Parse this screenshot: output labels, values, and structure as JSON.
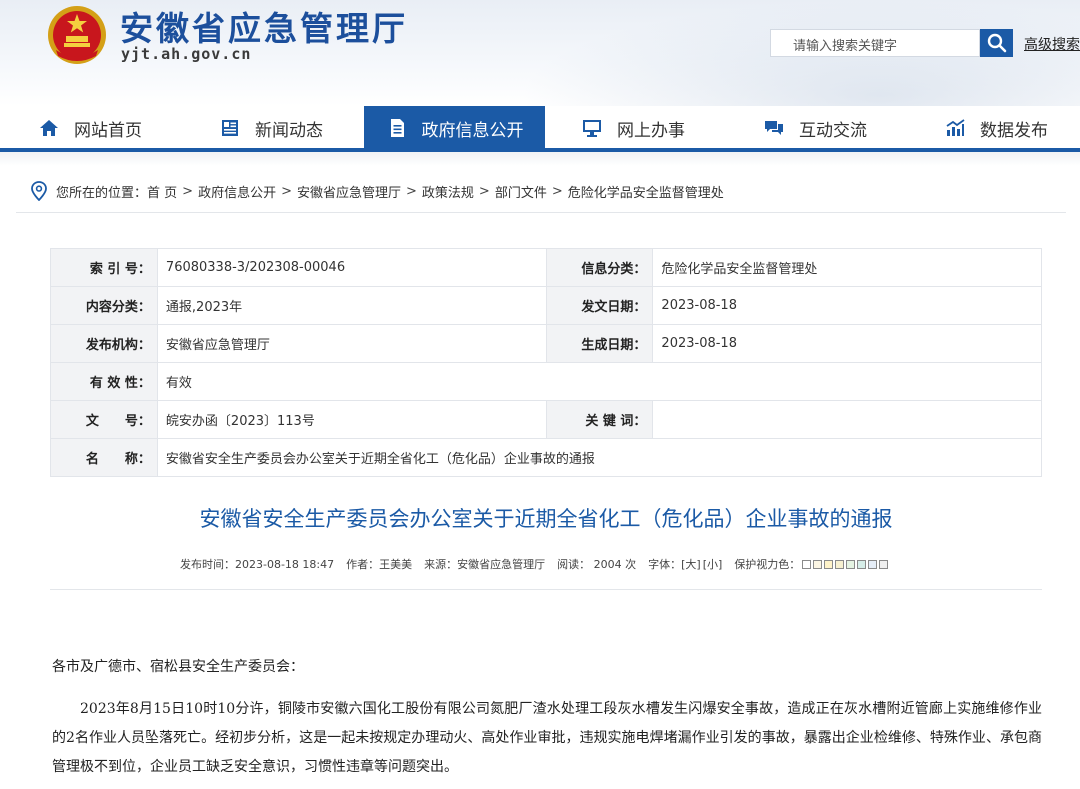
{
  "header": {
    "site_title": "安徽省应急管理厅",
    "site_domain": "yjt.ah.gov.cn",
    "search_placeholder": "请输入搜索关键字",
    "advanced_search": "高级搜索",
    "brand_color": "#1b5aa6"
  },
  "nav": {
    "items": [
      {
        "label": "网站首页",
        "icon": "home-icon"
      },
      {
        "label": "新闻动态",
        "icon": "news-icon"
      },
      {
        "label": "政府信息公开",
        "icon": "document-icon",
        "active": true
      },
      {
        "label": "网上办事",
        "icon": "monitor-icon"
      },
      {
        "label": "互动交流",
        "icon": "chat-icon"
      },
      {
        "label": "数据发布",
        "icon": "chart-icon"
      }
    ]
  },
  "breadcrumb": {
    "prefix": "您所在的位置：",
    "items": [
      "首 页",
      "政府信息公开",
      "安徽省应急管理厅",
      "政策法规",
      "部门文件",
      "危险化学品安全监督管理处"
    ]
  },
  "info": {
    "index_label": "索 引 号：",
    "index_value": "76080338-3/202308-00046",
    "category_label": "信息分类：",
    "category_value": "危险化学品安全监督管理处",
    "content_label": "内容分类：",
    "content_value": "通报,2023年",
    "issue_date_label": "发文日期：",
    "issue_date_value": "2023-08-18",
    "publisher_label": "发布机构：",
    "publisher_value": "安徽省应急管理厅",
    "created_label": "生成日期：",
    "created_value": "2023-08-18",
    "validity_label": "有 效 性：",
    "validity_value": "有效",
    "docno_label": "文　　号：",
    "docno_value": "皖安办函〔2023〕113号",
    "keywords_label": "关 键 词：",
    "keywords_value": "",
    "name_label": "名　　称：",
    "name_value": "安徽省安全生产委员会办公室关于近期全省化工（危化品）企业事故的通报"
  },
  "article": {
    "title": "安徽省安全生产委员会办公室关于近期全省化工（危化品）企业事故的通报",
    "meta": {
      "publish_time": "发布时间：2023-08-18 18:47",
      "author": "作者：王美美",
      "source": "来源：安徽省应急管理厅",
      "reads": "阅读：  2004  次",
      "font_label": "字体：",
      "font_large": "[大]",
      "font_small": "[小]",
      "eye_protect": "保护视力色：",
      "swatches": [
        "#ffffff",
        "#fbf5e3",
        "#fff3c9",
        "#f7f0d0",
        "#e5f3e2",
        "#d6ede8",
        "#e6eef8",
        "#f0f0f0"
      ]
    },
    "salutation": "各市及广德市、宿松县安全生产委员会：",
    "paragraph1": "2023年8月15日10时10分许，铜陵市安徽六国化工股份有限公司氮肥厂渣水处理工段灰水槽发生闪爆安全事故，造成正在灰水槽附近管廊上实施维修作业的2名作业人员坠落死亡。经初步分析，这是一起未按规定办理动火、高处作业审批，违规实施电焊堵漏作业引发的事故，暴露出企业检维修、特殊作业、承包商管理极不到位，企业员工缺乏安全意识，习惯性违章等问题突出。"
  }
}
